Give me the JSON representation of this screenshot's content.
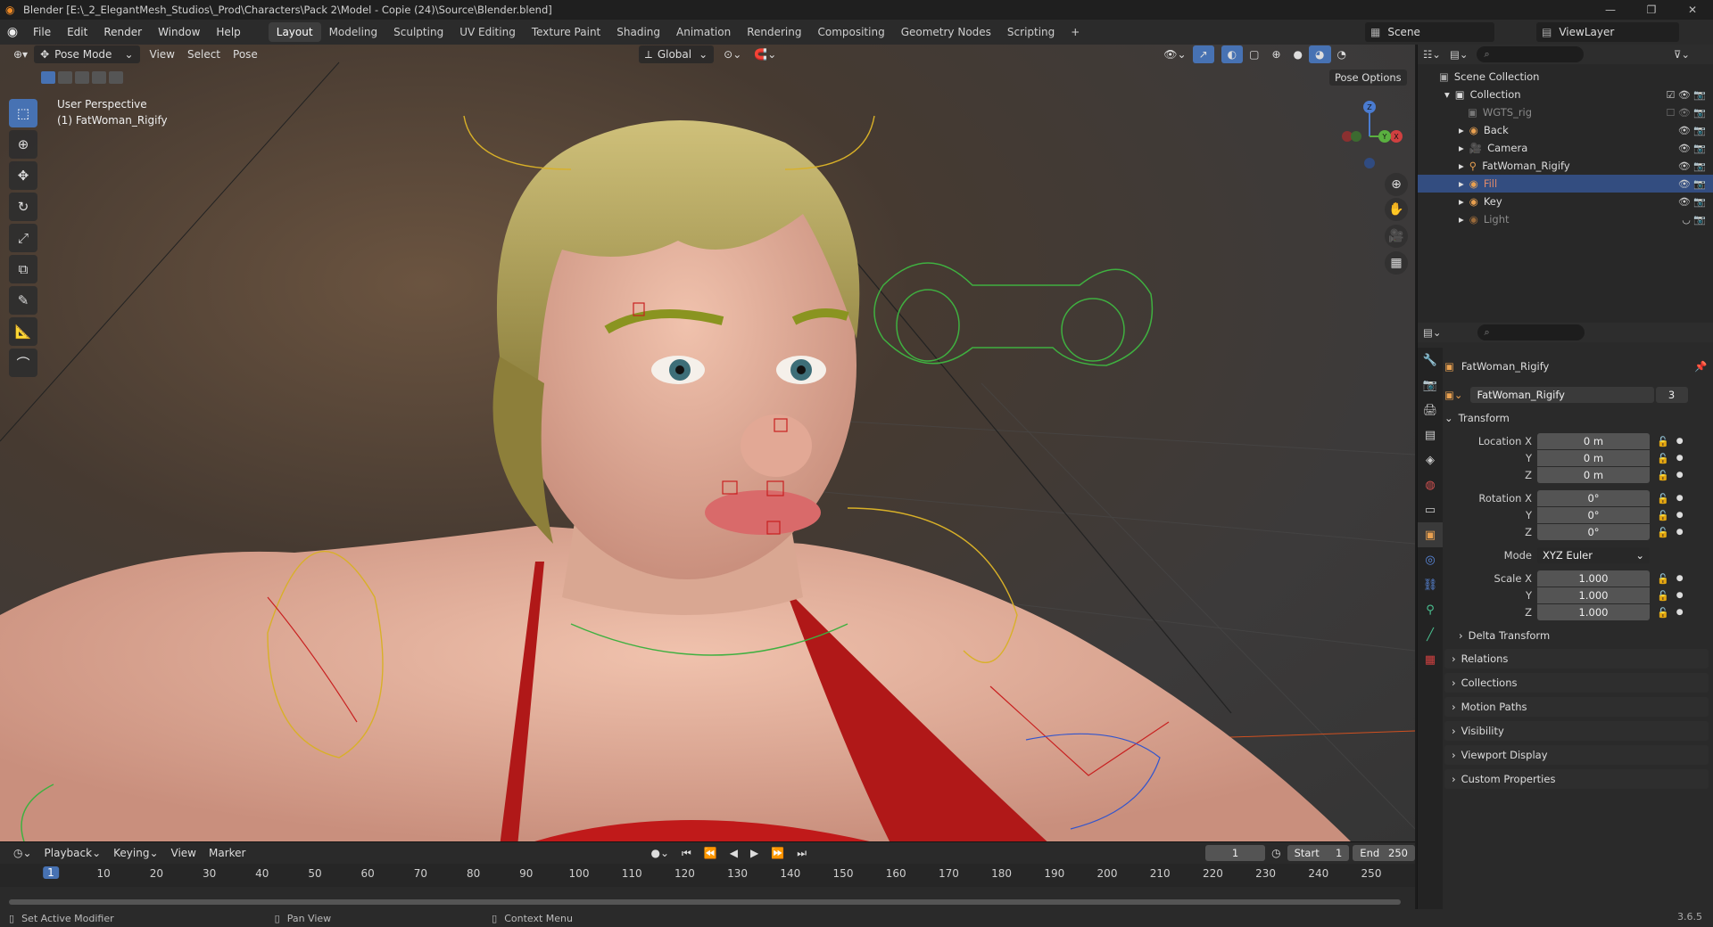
{
  "titlebar": {
    "title": "Blender [E:\\_2_ElegantMesh_Studios\\_Prod\\Characters\\Pack 2\\Model - Copie (24)\\Source\\Blender.blend]",
    "minimize": "—",
    "maximize": "❐",
    "close": "✕"
  },
  "menubar": {
    "menus": [
      "File",
      "Edit",
      "Render",
      "Window",
      "Help"
    ],
    "workspaces": [
      "Layout",
      "Modeling",
      "Sculpting",
      "UV Editing",
      "Texture Paint",
      "Shading",
      "Animation",
      "Rendering",
      "Compositing",
      "Geometry Nodes",
      "Scripting"
    ],
    "active_workspace": "Layout",
    "add_tab": "+",
    "scene": "Scene",
    "view_layer": "ViewLayer"
  },
  "viewport": {
    "mode": "Pose Mode",
    "menus": [
      "View",
      "Select",
      "Pose"
    ],
    "orientation": "Global",
    "pose_options": "Pose Options",
    "perspective": "User Perspective",
    "object": "(1) FatWoman_Rigify",
    "gizmo": {
      "x": "X",
      "y": "Y",
      "z": "Z"
    }
  },
  "timeline": {
    "menus": [
      "Playback",
      "Keying",
      "View",
      "Marker"
    ],
    "current_frame": "1",
    "start_label": "Start",
    "start": "1",
    "end_label": "End",
    "end": "250",
    "ticks": [
      "10",
      "20",
      "30",
      "40",
      "50",
      "60",
      "70",
      "80",
      "90",
      "100",
      "110",
      "120",
      "130",
      "140",
      "150",
      "160",
      "170",
      "180",
      "190",
      "200",
      "210",
      "220",
      "230",
      "240",
      "250"
    ]
  },
  "statusbar": {
    "left": "Set Active Modifier",
    "middle": "Pan View",
    "right": "Context Menu",
    "version": "3.6.5"
  },
  "outliner": {
    "scene_collection": "Scene Collection",
    "collection": "Collection",
    "items": [
      {
        "name": "WGTS_rig",
        "style": "dim"
      },
      {
        "name": "Back",
        "style": "normal"
      },
      {
        "name": "Camera",
        "style": "normal"
      },
      {
        "name": "FatWoman_Rigify",
        "style": "normal"
      },
      {
        "name": "Fill",
        "style": "red"
      },
      {
        "name": "Key",
        "style": "normal"
      },
      {
        "name": "Light",
        "style": "dim"
      }
    ]
  },
  "properties": {
    "object_name": "FatWoman_Rigify",
    "datablock": "FatWoman_Rigify",
    "users": "3",
    "transform_label": "Transform",
    "location_x_label": "Location X",
    "location_x": "0 m",
    "location_y_label": "Y",
    "location_y": "0 m",
    "location_z_label": "Z",
    "location_z": "0 m",
    "rotation_x_label": "Rotation X",
    "rotation_x": "0°",
    "rotation_y_label": "Y",
    "rotation_y": "0°",
    "rotation_z_label": "Z",
    "rotation_z": "0°",
    "mode_label": "Mode",
    "mode": "XYZ Euler",
    "scale_x_label": "Scale X",
    "scale_x": "1.000",
    "scale_y_label": "Y",
    "scale_y": "1.000",
    "scale_z_label": "Z",
    "scale_z": "1.000",
    "delta_transform": "Delta Transform",
    "sections": [
      "Relations",
      "Collections",
      "Motion Paths",
      "Visibility",
      "Viewport Display",
      "Custom Properties"
    ]
  },
  "colors": {
    "accent": "#4772b3",
    "selection": "#334d80",
    "bg": "#2a2a2a"
  }
}
